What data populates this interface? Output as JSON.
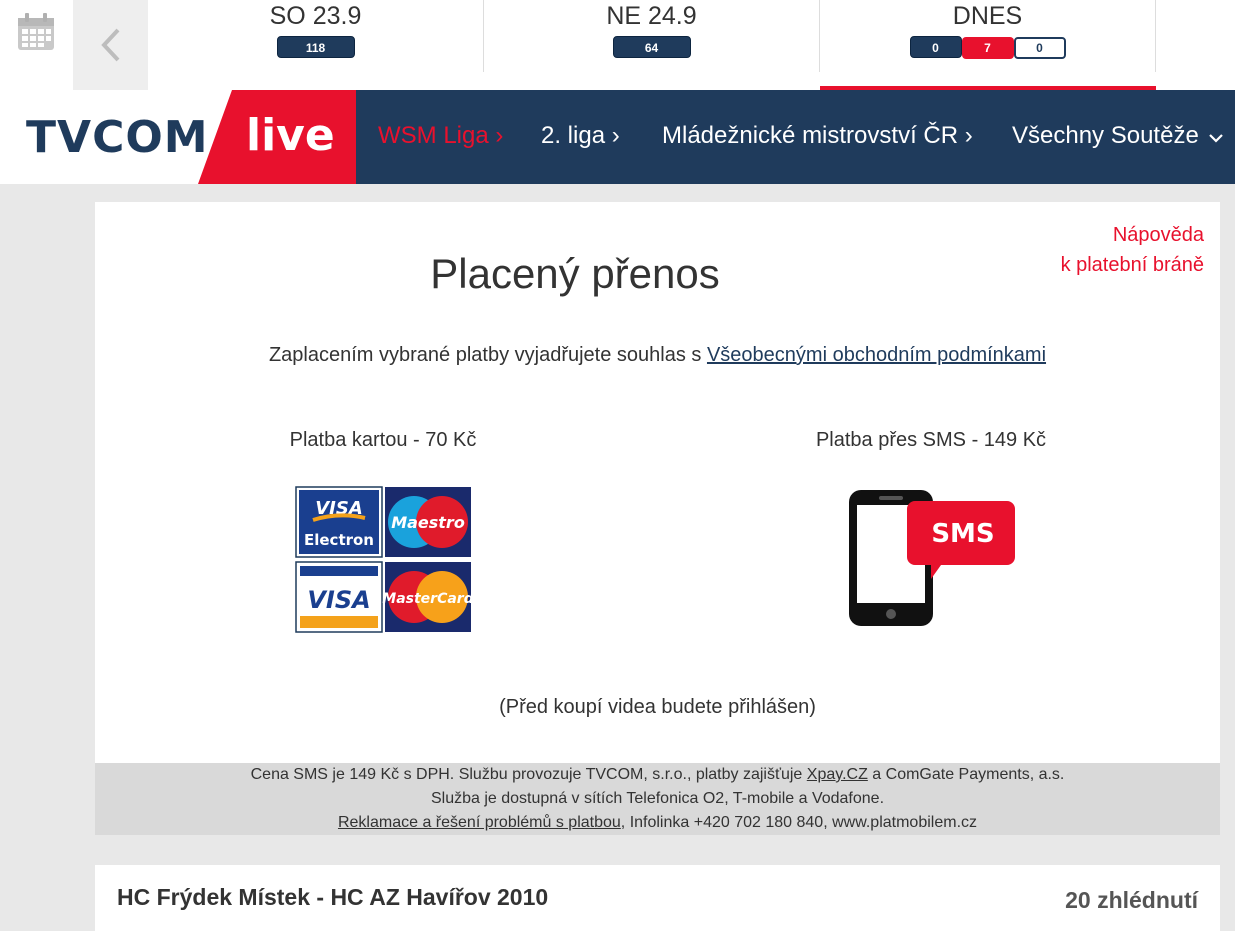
{
  "datebar": {
    "days": [
      {
        "label": "SO 23.9",
        "count": "118"
      },
      {
        "label": "NE 24.9",
        "count": "64"
      },
      {
        "label": "DNES",
        "counts": [
          "0",
          "7",
          "0"
        ]
      }
    ]
  },
  "header": {
    "logo": "TVCOM",
    "live": "live",
    "nav": [
      {
        "label": "WSM Liga ›"
      },
      {
        "label": "2. liga ›"
      },
      {
        "label": "Mládežnické mistrovství ČR ›"
      },
      {
        "label": "Všechny Soutěže"
      }
    ]
  },
  "payment": {
    "help_line1": "Nápověda",
    "help_line2": "k platební bráně",
    "title": "Placený přenos",
    "consent_text": "Zaplacením vybrané platby vyjadřujete souhlas s ",
    "consent_link": "Všeobecnými obchodním podmínkami",
    "card_option": "Platba kartou - 70 Kč",
    "sms_option": "Platba přes SMS - 149 Kč",
    "card_logos": [
      "VISA Electron",
      "Maestro",
      "VISA",
      "MasterCard"
    ],
    "sms_badge": "SMS",
    "login_note": "(Před koupí videa budete přihlášen)",
    "footer": {
      "line1_a": "Cena SMS je 149 Kč s DPH. Službu provozuje TVCOM, s.r.o., platby zajišťuje ",
      "line1_link": "Xpay.CZ",
      "line1_b": " a ComGate Payments, a.s.",
      "line2": "Služba je dostupná v sítích Telefonica O2, T-mobile a Vodafone.",
      "line3_link": "Reklamace a řešení problémů s platbou",
      "line3_b": ", Infolinka +420 702 180 840, www.platmobilem.cz"
    }
  },
  "match": {
    "title": "HC Frýdek Místek - HC AZ Havířov 2010",
    "views": "20 zhlédnutí"
  },
  "colors": {
    "navy": "#1f3b5c",
    "red": "#e8112d"
  }
}
